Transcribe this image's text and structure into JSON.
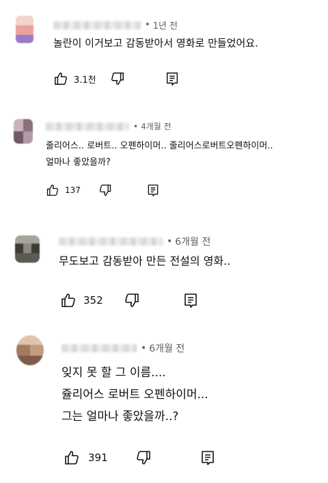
{
  "comments": [
    {
      "time": "1년 전",
      "separator": "•",
      "text": "놀란이 이거보고 감동받아서 영화로 만들었어요.",
      "likes": "3.1천",
      "avatar_colors": [
        "#f2b8b0",
        "#e9a39b",
        "#9b7bc4",
        "#f5d2cc"
      ]
    },
    {
      "time": "4개월 전",
      "separator": "•",
      "text": "줄리어스.. 로버트.. 오펜하이머.. 줄리어스로버트오펜하이머..\n얼마나 좋았을까?",
      "likes": "137",
      "avatar_colors": [
        "#b49aa6",
        "#8c6f7c",
        "#c8b4bd",
        "#6f5a64"
      ]
    },
    {
      "time": "6개월 전",
      "separator": "•",
      "text": "무도보고 감동받아 만든 전설의 영화..",
      "likes": "352",
      "avatar_colors": [
        "#5b5a55",
        "#8c8a80",
        "#3c3b38",
        "#a7a59b"
      ]
    },
    {
      "time": "6개월 전",
      "separator": "•",
      "text": "잊지 못 할 그 이름....\n쥴리어스 로버트 오펜하이머...\n그는 얼마나 좋았을까..?",
      "likes": "391",
      "avatar_colors": [
        "#c29b80",
        "#a27a60",
        "#e0c3ad",
        "#7e5c48"
      ]
    }
  ],
  "icons": {
    "like": "thumbs-up-icon",
    "dislike": "thumbs-down-icon",
    "reply": "reply-icon"
  }
}
